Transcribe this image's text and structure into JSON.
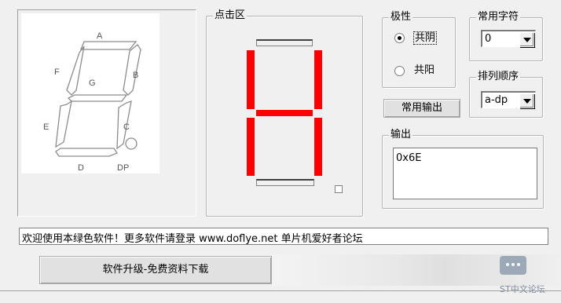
{
  "diagram_labels": {
    "a": "A",
    "b": "B",
    "c": "C",
    "d": "D",
    "e": "E",
    "f": "F",
    "g": "G",
    "dp": "DP"
  },
  "click_area": {
    "title": "点击区"
  },
  "polarity": {
    "title": "极性",
    "options": [
      {
        "label": "共阴",
        "selected": true
      },
      {
        "label": "共阳",
        "selected": false
      }
    ]
  },
  "common_char": {
    "title": "常用字符",
    "value": "0"
  },
  "order": {
    "title": "排列顺序",
    "value": "a-dp"
  },
  "common_output_button": "常用输出",
  "output": {
    "title": "输出",
    "value": "0x6E"
  },
  "status_text": "欢迎使用本绿色软件！更多软件请登录 www.doflye.net 单片机爱好者论坛",
  "upgrade_button": "软件升级-免费资料下载",
  "watermark": "ST中文论坛",
  "segment_color_on": "#ff0000",
  "segments_lit": [
    "b",
    "c",
    "e",
    "f",
    "g"
  ]
}
